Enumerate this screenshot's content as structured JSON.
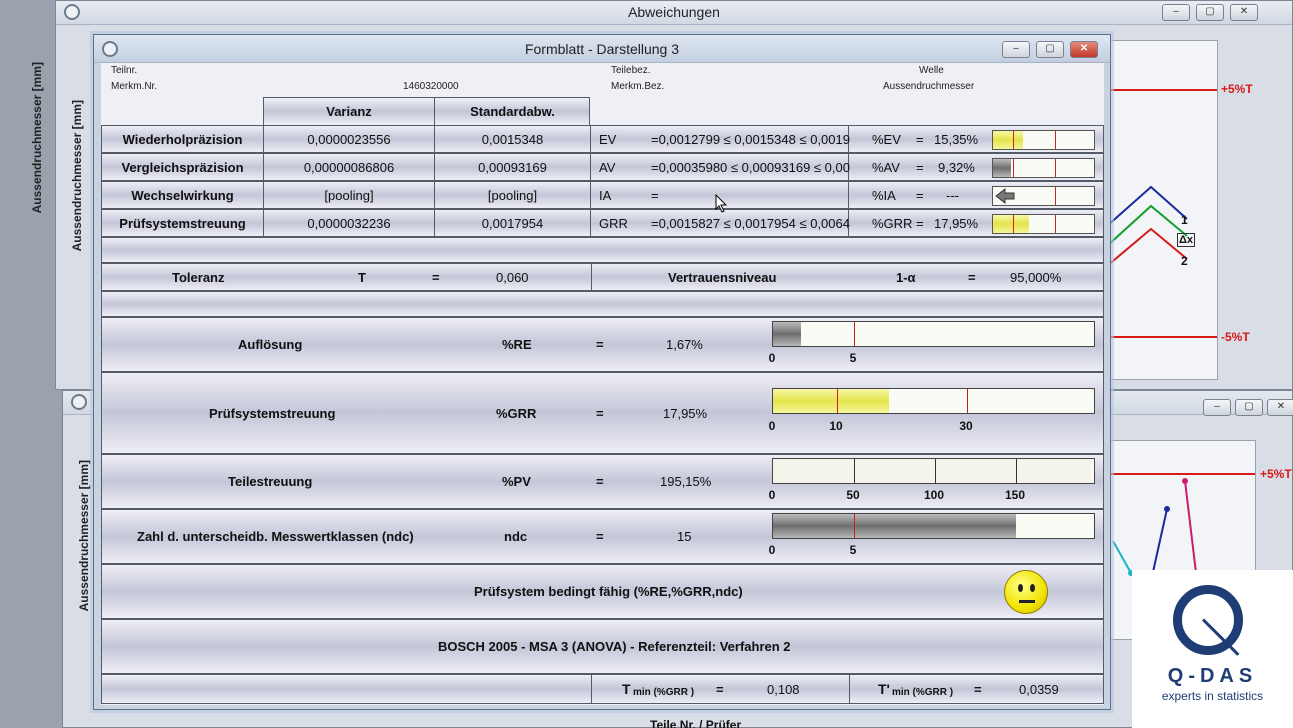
{
  "bg_window": {
    "title": "Abweichungen",
    "yaxis_label": "Aussendruchmesser [mm]",
    "btn_min": "–",
    "btn_max": "▢",
    "btn_close": "✕"
  },
  "bg_window2": {
    "yaxis_label": "Aussendruchmesser [mm]",
    "bottom_label": "Teile Nr. / Prüfer"
  },
  "chart_right": {
    "upper_label": "+5%T",
    "lower_label": "-5%T",
    "legend": [
      "1",
      "Δx",
      "2"
    ]
  },
  "chart_right2": {
    "upper_label": "+5%T"
  },
  "dialog": {
    "title": "Formblatt - Darstellung 3",
    "header": {
      "teilnr_label": "Teilnr.",
      "teilebez_label": "Teilebez.",
      "teilebez_value": "Welle",
      "merkmnr_label": "Merkm.Nr.",
      "merkmnr_value": "1460320000",
      "merkmbez_label": "Merkm.Bez.",
      "merkmbez_value": "Aussendruchmesser"
    },
    "columns": {
      "varianz": "Varianz",
      "stdabw": "Standardabw."
    },
    "rows": [
      {
        "label": "Wiederholpräzision",
        "varianz": "0,0000023556",
        "stdabw": "0,0015348",
        "code": "EV",
        "interval": "=0,0012799 ≤ 0,0015348 ≤ 0,0019",
        "pct_label": "%EV",
        "eq": "=",
        "pct": "15,35%",
        "fill": 0.2,
        "fill_color": "yellow"
      },
      {
        "label": "Vergleichspräzision",
        "varianz": "0,00000086806",
        "stdabw": "0,00093169",
        "code": "AV",
        "interval": "=0,00035980 ≤ 0,00093169 ≤ 0,00",
        "pct_label": "%AV",
        "eq": "=",
        "pct": "9,32%",
        "fill": 0.12,
        "fill_color": "gray"
      },
      {
        "label": "Wechselwirkung",
        "varianz": "[pooling]",
        "stdabw": "[pooling]",
        "code": "IA",
        "interval": "=",
        "pct_label": "%IA",
        "eq": "=",
        "pct": "---",
        "fill": 0,
        "fill_color": "none"
      },
      {
        "label": "Prüfsystemstreuung",
        "varianz": "0,0000032236",
        "stdabw": "0,0017954",
        "code": "GRR",
        "interval": "=0,0015827 ≤ 0,0017954 ≤ 0,0064",
        "pct_label": "%GRR",
        "eq": "=",
        "pct": "17,95%",
        "fill": 0.23,
        "fill_color": "yellow"
      }
    ],
    "toleranz": {
      "label": "Toleranz",
      "symbol": "T",
      "eq": "=",
      "value": "0,060",
      "vn_label": "Vertrauensniveau",
      "alpha": "1-α",
      "eq2": "=",
      "vn_value": "95,000%"
    },
    "metrics": [
      {
        "label": "Auflösung",
        "symbol": "%RE",
        "eq": "=",
        "value": "1,67%",
        "fill": 0.087,
        "ticks": [
          "0",
          "5"
        ]
      },
      {
        "label": "Prüfsystemstreuung",
        "symbol": "%GRR",
        "eq": "=",
        "value": "17,95%",
        "fill": 0.36,
        "ticks": [
          "0",
          "10",
          "30"
        ]
      },
      {
        "label": "Teilestreuung",
        "symbol": "%PV",
        "eq": "=",
        "value": "195,15%",
        "fill": 1.0,
        "ticks": [
          "0",
          "50",
          "100",
          "150"
        ]
      },
      {
        "label": "Zahl d. unterscheidb. Messwertklassen (ndc)",
        "symbol": "ndc",
        "eq": "=",
        "value": "15",
        "fill": 0.75,
        "ticks": [
          "0",
          "5"
        ]
      }
    ],
    "verdict": "Prüfsystem bedingt fähig (%RE,%GRR,ndc)",
    "method": "BOSCH 2005 - MSA 3 (ANOVA) - Referenzteil: Verfahren 2",
    "tmin": {
      "label": "T",
      "sub": "min (%GRR )",
      "eq": "=",
      "value": "0,108"
    },
    "tmin2": {
      "label": "T'",
      "sub": "min (%GRR )",
      "eq": "=",
      "value": "0,0359"
    }
  },
  "logo": {
    "brand": "Q-DAS",
    "tagline": "experts in statistics"
  },
  "colors": {
    "accent_red": "#d61a1a",
    "logo_blue": "#1e3d74",
    "fill_yellow": "#e3e34a"
  }
}
